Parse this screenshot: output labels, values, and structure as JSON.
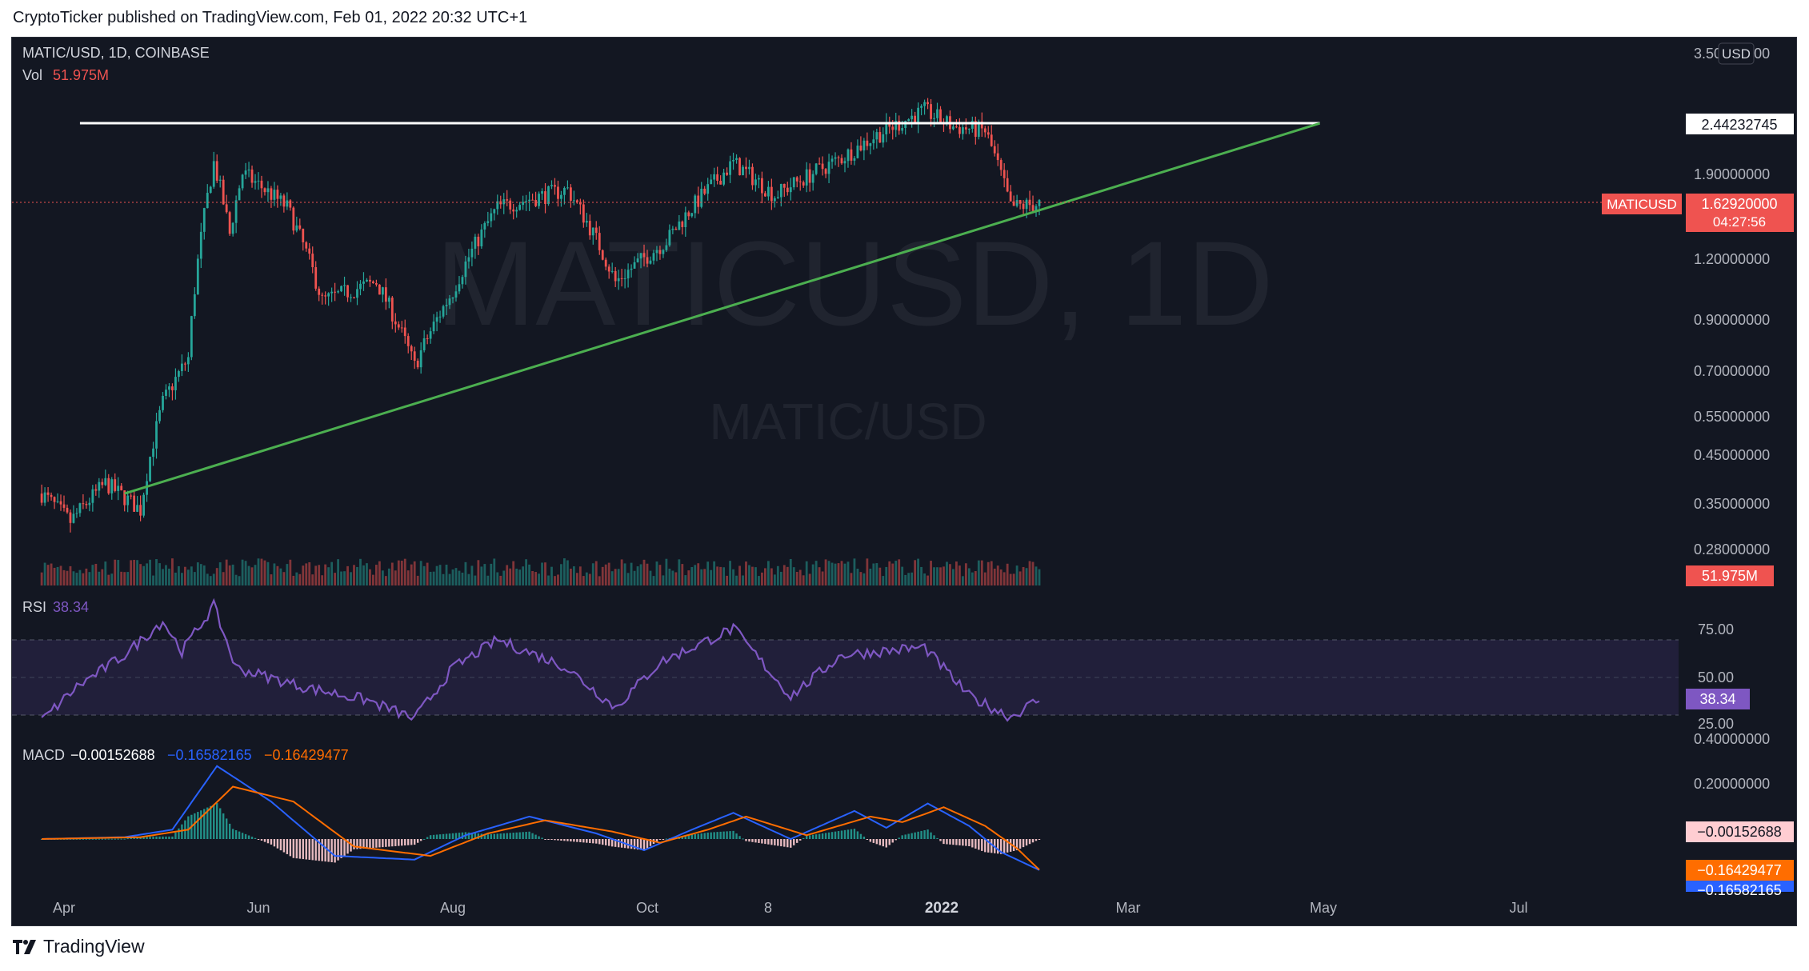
{
  "header": {
    "publisher_line": "CryptoTicker published on TradingView.com, Feb 01, 2022 20:32 UTC+1"
  },
  "footer": {
    "brand": "TradingView"
  },
  "watermark": {
    "symbol_big": "MATICUSD, 1D",
    "pair_name": "MATIC/USD"
  },
  "legend": {
    "symbol_line": "MATIC/USD, 1D, COINBASE",
    "vol_label": "Vol",
    "vol_value": "51.975M",
    "rsi_label": "RSI",
    "rsi_value": "38.34",
    "macd_label": "MACD",
    "macd_hist": "−0.00152688",
    "macd_line": "−0.16582165",
    "macd_signal": "−0.16429477"
  },
  "price_axis": {
    "currency": "USD",
    "top_label": "3.50000000",
    "ticks": [
      "1.90000000",
      "1.20000000",
      "0.90000000",
      "0.70000000",
      "0.55000000",
      "0.45000000",
      "0.35000000",
      "0.28000000"
    ],
    "resistance_label": "2.44232745",
    "current_symbol": "MATICUSD",
    "current_price": "1.62920000",
    "countdown": "04:27:56",
    "volume_label": "51.975M"
  },
  "rsi_axis": {
    "ticks": [
      "75.00",
      "50.00",
      "25.00"
    ],
    "value_label": "38.34"
  },
  "macd_axis": {
    "ticks": [
      "0.40000000",
      "0.20000000"
    ],
    "hist_label": "−0.00152688",
    "signal_label": "−0.16429477",
    "macd_label": "−0.16582165"
  },
  "time_axis": {
    "labels": [
      "Apr",
      "Jun",
      "Aug",
      "Oct",
      "8",
      "2022",
      "Mar",
      "May",
      "Jul"
    ]
  },
  "colors": {
    "up": "#26a69a",
    "down": "#ef5350",
    "background": "#131722",
    "resistance": "#ffffff",
    "trendline": "#4caf50",
    "rsi": "#7e57c2",
    "macd": "#2962ff",
    "signal": "#ff6d00"
  },
  "chart_data": {
    "type": "candlestick",
    "title": "MATIC/USD, 1D, COINBASE",
    "y_scale": "log",
    "ylim": [
      0.25,
      3.5
    ],
    "xlim": [
      "2021-03-25",
      "2022-07-31"
    ],
    "ohlc_close_checkpoints": [
      {
        "date": "2021-03-25",
        "close": 0.38
      },
      {
        "date": "2021-04-03",
        "close": 0.33
      },
      {
        "date": "2021-04-14",
        "close": 0.4
      },
      {
        "date": "2021-04-25",
        "close": 0.35
      },
      {
        "date": "2021-05-02",
        "close": 0.6
      },
      {
        "date": "2021-05-10",
        "close": 0.75
      },
      {
        "date": "2021-05-18",
        "close": 2.0
      },
      {
        "date": "2021-05-23",
        "close": 1.4
      },
      {
        "date": "2021-05-27",
        "close": 1.9
      },
      {
        "date": "2021-06-10",
        "close": 1.6
      },
      {
        "date": "2021-06-21",
        "close": 1.0
      },
      {
        "date": "2021-07-08",
        "close": 1.1
      },
      {
        "date": "2021-07-20",
        "close": 0.72
      },
      {
        "date": "2021-08-01",
        "close": 1.05
      },
      {
        "date": "2021-08-15",
        "close": 1.6
      },
      {
        "date": "2021-09-06",
        "close": 1.75
      },
      {
        "date": "2021-09-21",
        "close": 1.1
      },
      {
        "date": "2021-10-07",
        "close": 1.35
      },
      {
        "date": "2021-10-28",
        "close": 2.0
      },
      {
        "date": "2021-11-10",
        "close": 1.7
      },
      {
        "date": "2021-12-01",
        "close": 2.05
      },
      {
        "date": "2021-12-12",
        "close": 2.3
      },
      {
        "date": "2021-12-27",
        "close": 2.6
      },
      {
        "date": "2022-01-05",
        "close": 2.4
      },
      {
        "date": "2022-01-15",
        "close": 2.35
      },
      {
        "date": "2022-01-23",
        "close": 1.6
      },
      {
        "date": "2022-02-01",
        "close": 1.63
      }
    ],
    "volume": {
      "last": 51.975,
      "unit": "M"
    },
    "annotations": [
      {
        "type": "horizontal_line",
        "price": 2.44232745,
        "from": "2021-04-06",
        "to": "2022-04-30",
        "color": "#ffffff"
      },
      {
        "type": "trendline",
        "from": {
          "date": "2021-04-20",
          "price": 0.38
        },
        "to": {
          "date": "2022-04-30",
          "price": 2.44
        },
        "color": "#4caf50"
      }
    ],
    "rsi": {
      "ylim": [
        0,
        100
      ],
      "bands": [
        30,
        50,
        70
      ],
      "last": 38.34,
      "points": [
        {
          "date": "2021-03-25",
          "value": 27
        },
        {
          "date": "2021-04-05",
          "value": 45
        },
        {
          "date": "2021-04-20",
          "value": 62
        },
        {
          "date": "2021-05-02",
          "value": 80
        },
        {
          "date": "2021-05-08",
          "value": 64
        },
        {
          "date": "2021-05-18",
          "value": 88
        },
        {
          "date": "2021-05-25",
          "value": 55
        },
        {
          "date": "2021-06-15",
          "value": 45
        },
        {
          "date": "2021-07-05",
          "value": 38
        },
        {
          "date": "2021-07-20",
          "value": 28
        },
        {
          "date": "2021-08-01",
          "value": 55
        },
        {
          "date": "2021-08-15",
          "value": 70
        },
        {
          "date": "2021-09-05",
          "value": 56
        },
        {
          "date": "2021-09-21",
          "value": 34
        },
        {
          "date": "2021-10-05",
          "value": 58
        },
        {
          "date": "2021-10-28",
          "value": 76
        },
        {
          "date": "2021-11-15",
          "value": 40
        },
        {
          "date": "2021-12-01",
          "value": 62
        },
        {
          "date": "2021-12-27",
          "value": 66
        },
        {
          "date": "2022-01-10",
          "value": 40
        },
        {
          "date": "2022-01-23",
          "value": 29
        },
        {
          "date": "2022-02-01",
          "value": 38.34
        }
      ]
    },
    "macd": {
      "ylim": [
        -0.22,
        0.45
      ],
      "last_hist": -0.00152688,
      "last_macd": -0.16582165,
      "last_signal": -0.16429477,
      "macd_points": [
        {
          "date": "2021-03-25",
          "value": 0.0
        },
        {
          "date": "2021-04-20",
          "value": 0.01
        },
        {
          "date": "2021-05-05",
          "value": 0.05
        },
        {
          "date": "2021-05-19",
          "value": 0.39
        },
        {
          "date": "2021-06-05",
          "value": 0.2
        },
        {
          "date": "2021-06-25",
          "value": -0.09
        },
        {
          "date": "2021-07-20",
          "value": -0.11
        },
        {
          "date": "2021-08-05",
          "value": 0.02
        },
        {
          "date": "2021-08-25",
          "value": 0.12
        },
        {
          "date": "2021-09-15",
          "value": 0.03
        },
        {
          "date": "2021-09-30",
          "value": -0.06
        },
        {
          "date": "2021-10-15",
          "value": 0.05
        },
        {
          "date": "2021-10-28",
          "value": 0.14
        },
        {
          "date": "2021-11-15",
          "value": 0.0
        },
        {
          "date": "2021-12-05",
          "value": 0.15
        },
        {
          "date": "2021-12-15",
          "value": 0.06
        },
        {
          "date": "2021-12-28",
          "value": 0.19
        },
        {
          "date": "2022-01-10",
          "value": 0.07
        },
        {
          "date": "2022-01-20",
          "value": -0.07
        },
        {
          "date": "2022-02-01",
          "value": -0.16582165
        }
      ],
      "signal_points": [
        {
          "date": "2021-03-25",
          "value": 0.0
        },
        {
          "date": "2021-04-25",
          "value": 0.01
        },
        {
          "date": "2021-05-10",
          "value": 0.05
        },
        {
          "date": "2021-05-24",
          "value": 0.28
        },
        {
          "date": "2021-06-12",
          "value": 0.2
        },
        {
          "date": "2021-07-01",
          "value": -0.04
        },
        {
          "date": "2021-07-25",
          "value": -0.09
        },
        {
          "date": "2021-08-12",
          "value": 0.03
        },
        {
          "date": "2021-08-30",
          "value": 0.1
        },
        {
          "date": "2021-09-20",
          "value": 0.04
        },
        {
          "date": "2021-10-05",
          "value": -0.02
        },
        {
          "date": "2021-10-20",
          "value": 0.05
        },
        {
          "date": "2021-11-01",
          "value": 0.12
        },
        {
          "date": "2021-11-20",
          "value": 0.02
        },
        {
          "date": "2021-12-10",
          "value": 0.12
        },
        {
          "date": "2021-12-20",
          "value": 0.09
        },
        {
          "date": "2022-01-02",
          "value": 0.17
        },
        {
          "date": "2022-01-15",
          "value": 0.07
        },
        {
          "date": "2022-01-25",
          "value": -0.05
        },
        {
          "date": "2022-02-01",
          "value": -0.16429477
        }
      ]
    }
  }
}
